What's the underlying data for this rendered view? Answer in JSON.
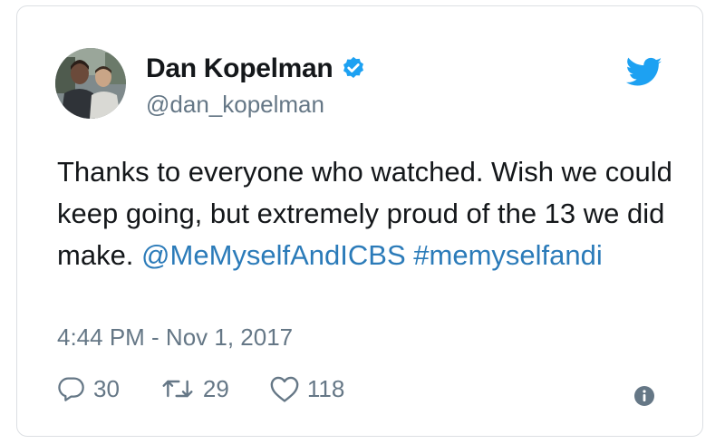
{
  "tweet": {
    "author": {
      "display_name": "Dan Kopelman",
      "handle": "@dan_kopelman",
      "verified": true
    },
    "text_plain": "Thanks to everyone who watched. Wish we could keep going, but extremely proud of the 13 we did make. ",
    "mention": "@MeMyselfAndICBS",
    "hashtag": "#memyselfandi",
    "timestamp": "4:44 PM - Nov 1, 2017",
    "stats": {
      "replies": "30",
      "retweets": "29",
      "likes": "118"
    }
  },
  "colors": {
    "link": "#2b7bb9",
    "verified": "#1da1f2",
    "bird": "#1da1f2",
    "secondary_text": "#657786",
    "primary_text": "#14171a"
  },
  "icons": {
    "brand": "twitter-bird-icon",
    "verified": "verified-badge-icon",
    "reply": "reply-icon",
    "retweet": "retweet-icon",
    "like": "heart-icon",
    "info": "info-icon"
  }
}
